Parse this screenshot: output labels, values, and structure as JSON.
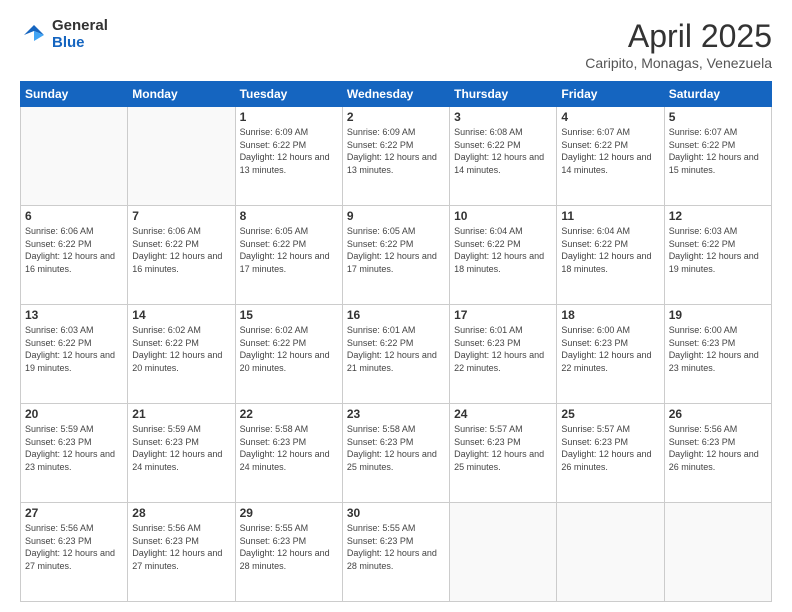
{
  "logo": {
    "general": "General",
    "blue": "Blue"
  },
  "header": {
    "title": "April 2025",
    "subtitle": "Caripito, Monagas, Venezuela"
  },
  "days_of_week": [
    "Sunday",
    "Monday",
    "Tuesday",
    "Wednesday",
    "Thursday",
    "Friday",
    "Saturday"
  ],
  "weeks": [
    [
      {
        "day": "",
        "info": ""
      },
      {
        "day": "",
        "info": ""
      },
      {
        "day": "1",
        "info": "Sunrise: 6:09 AM\nSunset: 6:22 PM\nDaylight: 12 hours and 13 minutes."
      },
      {
        "day": "2",
        "info": "Sunrise: 6:09 AM\nSunset: 6:22 PM\nDaylight: 12 hours and 13 minutes."
      },
      {
        "day": "3",
        "info": "Sunrise: 6:08 AM\nSunset: 6:22 PM\nDaylight: 12 hours and 14 minutes."
      },
      {
        "day": "4",
        "info": "Sunrise: 6:07 AM\nSunset: 6:22 PM\nDaylight: 12 hours and 14 minutes."
      },
      {
        "day": "5",
        "info": "Sunrise: 6:07 AM\nSunset: 6:22 PM\nDaylight: 12 hours and 15 minutes."
      }
    ],
    [
      {
        "day": "6",
        "info": "Sunrise: 6:06 AM\nSunset: 6:22 PM\nDaylight: 12 hours and 16 minutes."
      },
      {
        "day": "7",
        "info": "Sunrise: 6:06 AM\nSunset: 6:22 PM\nDaylight: 12 hours and 16 minutes."
      },
      {
        "day": "8",
        "info": "Sunrise: 6:05 AM\nSunset: 6:22 PM\nDaylight: 12 hours and 17 minutes."
      },
      {
        "day": "9",
        "info": "Sunrise: 6:05 AM\nSunset: 6:22 PM\nDaylight: 12 hours and 17 minutes."
      },
      {
        "day": "10",
        "info": "Sunrise: 6:04 AM\nSunset: 6:22 PM\nDaylight: 12 hours and 18 minutes."
      },
      {
        "day": "11",
        "info": "Sunrise: 6:04 AM\nSunset: 6:22 PM\nDaylight: 12 hours and 18 minutes."
      },
      {
        "day": "12",
        "info": "Sunrise: 6:03 AM\nSunset: 6:22 PM\nDaylight: 12 hours and 19 minutes."
      }
    ],
    [
      {
        "day": "13",
        "info": "Sunrise: 6:03 AM\nSunset: 6:22 PM\nDaylight: 12 hours and 19 minutes."
      },
      {
        "day": "14",
        "info": "Sunrise: 6:02 AM\nSunset: 6:22 PM\nDaylight: 12 hours and 20 minutes."
      },
      {
        "day": "15",
        "info": "Sunrise: 6:02 AM\nSunset: 6:22 PM\nDaylight: 12 hours and 20 minutes."
      },
      {
        "day": "16",
        "info": "Sunrise: 6:01 AM\nSunset: 6:22 PM\nDaylight: 12 hours and 21 minutes."
      },
      {
        "day": "17",
        "info": "Sunrise: 6:01 AM\nSunset: 6:23 PM\nDaylight: 12 hours and 22 minutes."
      },
      {
        "day": "18",
        "info": "Sunrise: 6:00 AM\nSunset: 6:23 PM\nDaylight: 12 hours and 22 minutes."
      },
      {
        "day": "19",
        "info": "Sunrise: 6:00 AM\nSunset: 6:23 PM\nDaylight: 12 hours and 23 minutes."
      }
    ],
    [
      {
        "day": "20",
        "info": "Sunrise: 5:59 AM\nSunset: 6:23 PM\nDaylight: 12 hours and 23 minutes."
      },
      {
        "day": "21",
        "info": "Sunrise: 5:59 AM\nSunset: 6:23 PM\nDaylight: 12 hours and 24 minutes."
      },
      {
        "day": "22",
        "info": "Sunrise: 5:58 AM\nSunset: 6:23 PM\nDaylight: 12 hours and 24 minutes."
      },
      {
        "day": "23",
        "info": "Sunrise: 5:58 AM\nSunset: 6:23 PM\nDaylight: 12 hours and 25 minutes."
      },
      {
        "day": "24",
        "info": "Sunrise: 5:57 AM\nSunset: 6:23 PM\nDaylight: 12 hours and 25 minutes."
      },
      {
        "day": "25",
        "info": "Sunrise: 5:57 AM\nSunset: 6:23 PM\nDaylight: 12 hours and 26 minutes."
      },
      {
        "day": "26",
        "info": "Sunrise: 5:56 AM\nSunset: 6:23 PM\nDaylight: 12 hours and 26 minutes."
      }
    ],
    [
      {
        "day": "27",
        "info": "Sunrise: 5:56 AM\nSunset: 6:23 PM\nDaylight: 12 hours and 27 minutes."
      },
      {
        "day": "28",
        "info": "Sunrise: 5:56 AM\nSunset: 6:23 PM\nDaylight: 12 hours and 27 minutes."
      },
      {
        "day": "29",
        "info": "Sunrise: 5:55 AM\nSunset: 6:23 PM\nDaylight: 12 hours and 28 minutes."
      },
      {
        "day": "30",
        "info": "Sunrise: 5:55 AM\nSunset: 6:23 PM\nDaylight: 12 hours and 28 minutes."
      },
      {
        "day": "",
        "info": ""
      },
      {
        "day": "",
        "info": ""
      },
      {
        "day": "",
        "info": ""
      }
    ]
  ]
}
